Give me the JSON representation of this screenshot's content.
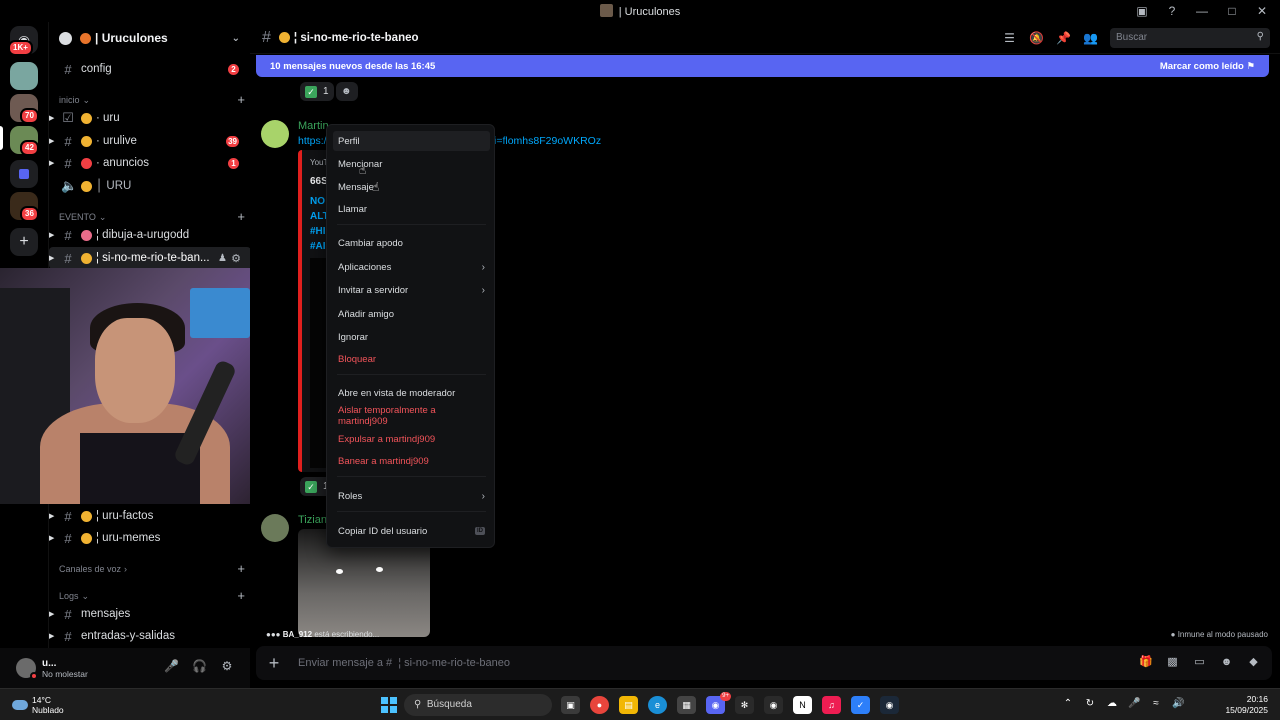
{
  "window": {
    "title": "| Uruculones"
  },
  "rail": {
    "badges": [
      "1K+",
      "70",
      "42",
      "36"
    ]
  },
  "sidebar": {
    "guild_name": "| Uruculones",
    "channels_top": [
      {
        "name": "config",
        "badge": "2"
      }
    ],
    "category_inicio": "inicio",
    "inicio_channels": [
      {
        "name": "· uru",
        "badge": ""
      },
      {
        "name": "· urulive",
        "badge": "39"
      },
      {
        "name": "· anuncios",
        "badge": "1"
      },
      {
        "name": "│ URU",
        "badge": ""
      }
    ],
    "category_evento": "EVENTO",
    "evento_channels": [
      {
        "name": "¦ dibuja-a-urugodd"
      },
      {
        "name": "¦ si-no-me-rio-te-ban..."
      }
    ],
    "more_channels": [
      {
        "name": "¦ uru-factos"
      },
      {
        "name": "¦ uru-memes"
      }
    ],
    "category_voz": "Canales de voz",
    "category_logs": "Logs",
    "logs_channels": [
      {
        "name": "mensajes"
      },
      {
        "name": "entradas-y-salidas"
      }
    ]
  },
  "user_panel": {
    "name": "u...",
    "status": "No molestar"
  },
  "header": {
    "channel_name": "¦ si-no-me-rio-te-baneo",
    "search_placeholder": "Buscar"
  },
  "new_messages_bar": {
    "text": "10 mensajes nuevos desde las 16:45",
    "action": "Marcar como leído"
  },
  "messages": [
    {
      "author": "Martin",
      "link": "https://",
      "link_tail": "i=flomhs8F29oWKROz",
      "embed": {
        "provider": "YouT",
        "title": "66S",
        "tags": [
          "NO",
          "ALT",
          "#HI",
          "#AI"
        ]
      },
      "reaction_count": "1"
    },
    {
      "author": "Tizian"
    }
  ],
  "top_reaction_count": "1",
  "typing": {
    "user": "BA_912",
    "text": "está escribiendo..."
  },
  "paused_text": "Inmune al modo pausado",
  "composer": {
    "placeholder": "Enviar mensaje a #  ¦ si-no-me-rio-te-baneo"
  },
  "context_menu": {
    "perfil": "Perfil",
    "mencionar": "Mencionar",
    "mensaje": "Mensaje",
    "llamar": "Llamar",
    "cambiar_apodo": "Cambiar apodo",
    "aplicaciones": "Aplicaciones",
    "invitar": "Invitar a servidor",
    "anadir_amigo": "Añadir amigo",
    "ignorar": "Ignorar",
    "bloquear": "Bloquear",
    "abre_moderador": "Abre en vista de moderador",
    "aislar": "Aislar temporalmente a martindj909",
    "expulsar": "Expulsar a martindj909",
    "banear": "Banear a martindj909",
    "roles": "Roles",
    "copiar_id": "Copiar ID del usuario",
    "id_badge": "ID"
  },
  "taskbar": {
    "weather_temp": "14°C",
    "weather_desc": "Nublado",
    "search": "Búsqueda",
    "time": "20:16",
    "date": "15/09/2025",
    "discord_badge": "9+"
  },
  "colors": {
    "accent": "#5865f2",
    "danger": "#f2545a",
    "link": "#00a8fc",
    "online_green": "#3ba55c"
  }
}
